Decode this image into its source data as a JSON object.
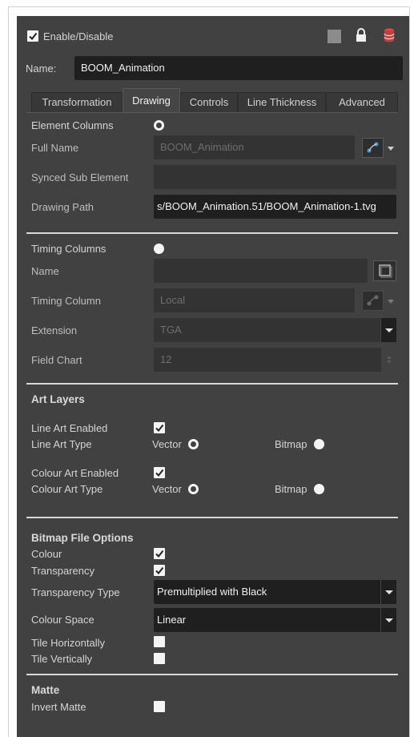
{
  "header": {
    "enable_label": "Enable/Disable",
    "enabled": true,
    "icons": [
      "square-icon",
      "lock-icon",
      "database-icon"
    ]
  },
  "name": {
    "label": "Name:",
    "value": "BOOM_Animation"
  },
  "tabs": [
    {
      "label": "Transformation",
      "active": false
    },
    {
      "label": "Drawing",
      "active": true
    },
    {
      "label": "Controls",
      "active": false
    },
    {
      "label": "Line Thickness",
      "active": false
    },
    {
      "label": "Advanced",
      "active": false
    }
  ],
  "element": {
    "columns_label": "Element Columns",
    "full_name_label": "Full Name",
    "full_name_value": "BOOM_Animation",
    "synced_label": "Synced Sub Element",
    "synced_value": "",
    "path_label": "Drawing Path",
    "path_value": "s/BOOM_Animation.51/BOOM_Animation-1.tvg"
  },
  "timing": {
    "columns_label": "Timing Columns",
    "name_label": "Name",
    "name_value": "",
    "column_label": "Timing Column",
    "column_value": "Local",
    "extension_label": "Extension",
    "extension_value": "TGA",
    "field_chart_label": "Field Chart",
    "field_chart_value": "12"
  },
  "art_layers": {
    "title": "Art Layers",
    "line_enabled_label": "Line Art Enabled",
    "line_type_label": "Line Art Type",
    "colour_enabled_label": "Colour Art Enabled",
    "colour_type_label": "Colour Art Type",
    "vector_label": "Vector",
    "bitmap_label": "Bitmap",
    "line_enabled": true,
    "colour_enabled": true
  },
  "bitmap": {
    "title": "Bitmap File Options",
    "colour_label": "Colour",
    "transparency_label": "Transparency",
    "transparency_type_label": "Transparency Type",
    "transparency_type_value": "Premultiplied with Black",
    "colour_space_label": "Colour Space",
    "colour_space_value": "Linear",
    "tile_h_label": "Tile Horizontally",
    "tile_v_label": "Tile Vertically",
    "colour_checked": true,
    "transparency_checked": true,
    "tile_h_checked": false,
    "tile_v_checked": false
  },
  "matte": {
    "title": "Matte",
    "invert_label": "Invert Matte",
    "invert_checked": false
  },
  "colors": {
    "panel_bg": "#414141",
    "field_bg": "#333333",
    "dark_field_bg": "#1f1f1f",
    "link_icon_blue": "#3aa0e8",
    "db_icon_red": "#d94a4a"
  }
}
